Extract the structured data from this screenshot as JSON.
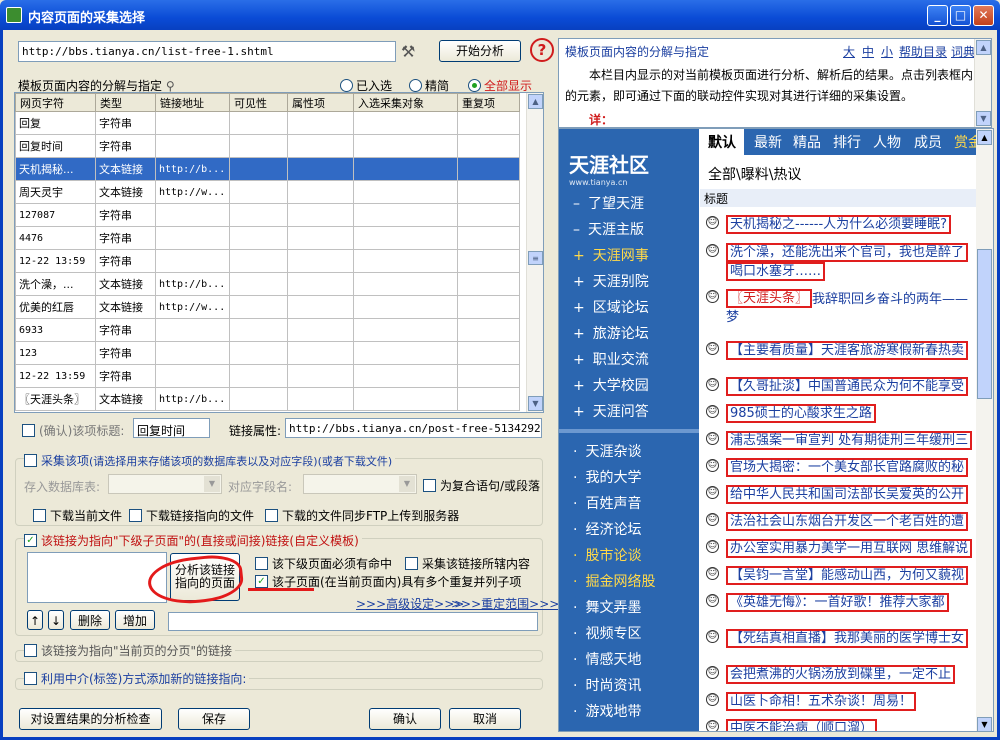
{
  "window": {
    "title": "内容页面的采集选择",
    "min": "_",
    "max": "□",
    "close": "✕"
  },
  "url": {
    "value": "http://bbs.tianya.cn/list-free-1.shtml"
  },
  "analyze_button": "开始分析",
  "template_label": "模板页面内容的分解与指定",
  "radios": [
    {
      "label": "已入选",
      "on": false
    },
    {
      "label": "精简",
      "on": false
    },
    {
      "label": "全部显示",
      "on": true
    }
  ],
  "grid": {
    "headers": [
      "网页字符",
      "类型",
      "链接地址",
      "可见性",
      "属性项",
      "入选采集对象",
      "重复项"
    ],
    "rows": [
      [
        "回复",
        "字符串",
        ""
      ],
      [
        "回复时间",
        "字符串",
        ""
      ],
      [
        "天机揭秘...",
        "文本链接",
        "http://b..."
      ],
      [
        "周天灵宇",
        "文本链接",
        "http://w..."
      ],
      [
        "127087",
        "字符串",
        ""
      ],
      [
        "4476",
        "字符串",
        ""
      ],
      [
        "12-22 13:59",
        "字符串",
        ""
      ],
      [
        "洗个澡，...",
        "文本链接",
        "http://b..."
      ],
      [
        "优美的红唇",
        "文本链接",
        "http://w..."
      ],
      [
        "6933",
        "字符串",
        ""
      ],
      [
        "123",
        "字符串",
        ""
      ],
      [
        "12-22 13:59",
        "字符串",
        ""
      ],
      [
        "〖天涯头条〗",
        "文本链接",
        "http://b..."
      ]
    ],
    "selected_row": 2
  },
  "confirm_title_label": "(确认)该项标题:",
  "confirm_title_value": "回复时间",
  "link_attr_label": "链接属性:",
  "link_attr_value": "http://bbs.tianya.cn/post-free-5134292-1.s",
  "collect_item": {
    "label": "采集该项",
    "hint": "(请选择用来存储该项的数据库表以及对应字段)(或者下载文件)",
    "db_table_label": "存入数据库表:",
    "field_label": "对应字段名:",
    "compound_label": "为复合语句/或段落",
    "dl_current": "下载当前文件",
    "dl_link": "下载链接指向的文件",
    "dl_ftp": "下载的文件同步FTP上传到服务器"
  },
  "sublink": {
    "label": "该链接为指向\"下级子页面\"的(直接或间接)链接(自定义模板)",
    "analyze_btn_l1": "分析该链接",
    "analyze_btn_l2": "指向的页面",
    "must_hit": "该下级页面必须有命中",
    "collect_content": "采集该链接所辖内容",
    "repeat_child": "该子页面(在当前页面内)具有多个重复并列子项",
    "advanced": ">>>高级设定>>>",
    "reset_range": ">>>重定范围>>>",
    "up": "↑",
    "down": "↓",
    "delete": "删除",
    "add": "增加"
  },
  "paging_label": "该链接为指向\"当前页的分页\"的链接",
  "intermediary_label": "利用中介(标签)方式添加新的链接指向:",
  "bottom_buttons": {
    "check": "对设置结果的分析检查",
    "save": "保存",
    "ok": "确认",
    "cancel": "取消"
  },
  "help": {
    "title": "模板页面内容的分解与指定",
    "links": [
      "大",
      "中",
      "小",
      "帮助目录",
      "词典"
    ],
    "body": "本栏目内显示的对当前模板页面进行分析、解析后的结果。点击列表框内的元素，即可通过下面的联动控件实现对其进行详细的采集设置。",
    "note": "详："
  },
  "tianya": {
    "logo": "天涯社区",
    "logo_sub": "www.tianya.cn",
    "nav": [
      {
        "label": "了望天涯",
        "mark": "–",
        "hl": false
      },
      {
        "label": "天涯主版",
        "mark": "–",
        "hl": false
      },
      {
        "label": "天涯网事",
        "mark": "+",
        "hl": true
      },
      {
        "label": "天涯别院",
        "mark": "+",
        "hl": false
      },
      {
        "label": "区域论坛",
        "mark": "+",
        "hl": false
      },
      {
        "label": "旅游论坛",
        "mark": "+",
        "hl": false
      },
      {
        "label": "职业交流",
        "mark": "+",
        "hl": false
      },
      {
        "label": "大学校园",
        "mark": "+",
        "hl": false
      },
      {
        "label": "天涯问答",
        "mark": "+",
        "hl": false
      },
      {
        "label": "天涯杂谈",
        "mark": "·",
        "hl": false
      },
      {
        "label": "我的大学",
        "mark": "·",
        "hl": false
      },
      {
        "label": "百姓声音",
        "mark": "·",
        "hl": false
      },
      {
        "label": "经济论坛",
        "mark": "·",
        "hl": false
      },
      {
        "label": "股市论谈",
        "mark": "·",
        "hl": true
      },
      {
        "label": "掘金网络股",
        "mark": "·",
        "hl": true
      },
      {
        "label": "舞文弄墨",
        "mark": "·",
        "hl": false
      },
      {
        "label": "视频专区",
        "mark": "·",
        "hl": false
      },
      {
        "label": "情感天地",
        "mark": "·",
        "hl": false
      },
      {
        "label": "时尚资讯",
        "mark": "·",
        "hl": false
      },
      {
        "label": "游戏地带",
        "mark": "·",
        "hl": false
      }
    ],
    "tabs": [
      "默认",
      "最新",
      "精品",
      "排行",
      "人物",
      "成员",
      "赏金"
    ],
    "breadcrumb": "全部\\曝料\\热议",
    "col_title": "标题",
    "posts": [
      "天机揭秘之------人为什么必须要睡眠?",
      "洗个澡，还能洗出来个官司，我也是醉了",
      "喝口水塞牙……",
      "〖天涯头条〗",
      "我辞职回乡奋斗的两年——",
      "梦",
      "【主要看质量】天涯客旅游寒假新春热卖",
      "【久哥扯淡】中国普通民众为何不能享受",
      "985硕士的心酸求生之路",
      "浦志强案一审宣判 处有期徒刑三年缓刑三",
      "官场大揭密：一个美女部长官路腐败的秘",
      "给中华人民共和国司法部长吴爱英的公开",
      "法治社会山东烟台开发区一个老百姓的遭",
      "办公室实用暴力美学一用互联网 思维解说",
      "【吴钧一言堂】能感动山西，为何又藐视",
      "《英雄无悔》：一首好歌！推荐大家都",
      "【死结真相直播】我那美丽的医学博士女",
      "会把煮沸的火锅汤放到碟里，一定不止",
      "山医卜命相！五术杂谈！周易！",
      "中医不能治病（顺口溜）"
    ]
  }
}
